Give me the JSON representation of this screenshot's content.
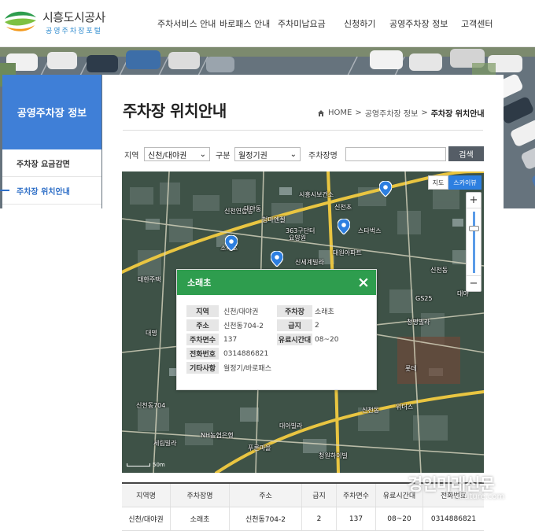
{
  "header": {
    "logo_name": "시흥도시공사",
    "logo_sub": "공영주차장포털",
    "nav": [
      "주차서비스 안내",
      "바로패스 안내",
      "주차미납요금",
      "신청하기",
      "공영주차장 정보",
      "고객센터"
    ]
  },
  "sidebar": {
    "title": "공영주차장 정보",
    "items": [
      {
        "label": "주차장 요금감면"
      },
      {
        "label": "주차장 위치안내"
      }
    ]
  },
  "page": {
    "title": "주차장 위치안내",
    "breadcrumb": {
      "home": "HOME",
      "sep": ">",
      "parent": "공영주차장 정보",
      "current": "주차장 위치안내"
    }
  },
  "filter": {
    "region_label": "지역",
    "region_value": "신천/대야권",
    "type_label": "구분",
    "type_value": "월정기권",
    "name_label": "주차장명",
    "name_value": "",
    "search_label": "검색"
  },
  "map": {
    "type_map": "지도",
    "type_sky": "스카이뷰",
    "zoom_in": "+",
    "zoom_out": "−",
    "labels": [
      "시흥시보건소",
      "신천연합동",
      "대야동",
      "363구단터",
      "요양원",
      "스타벅스",
      "청마엔젤",
      "신세계빌라",
      "대원아파트",
      "신천초",
      "GS25",
      "대야",
      "신천동",
      "대한주택",
      "소래초",
      "롯데",
      "청명빌라",
      "대명",
      "위더스",
      "NH농협은행",
      "신천동",
      "세림빌라",
      "청원하이빌",
      "푸른마을",
      "대아빌라",
      "신천동704"
    ],
    "scale": "50m",
    "popup": {
      "title": "소래초",
      "close": "×",
      "rows": [
        {
          "l1": "지역",
          "v1": "신천/대야권",
          "l2": "주차장",
          "v2": "소래초"
        },
        {
          "l1": "주소",
          "v1": "신천동704-2",
          "l2": "급지",
          "v2": "2"
        },
        {
          "l1": "주차면수",
          "v1": "137",
          "l2": "유료시간대",
          "v2": "08~20"
        },
        {
          "l1": "전화번호",
          "v1": "0314886821"
        },
        {
          "l1": "기타사항",
          "v1": "월정기/바로패스"
        }
      ]
    }
  },
  "table": {
    "headers": [
      "지역명",
      "주차장명",
      "주소",
      "급지",
      "주차면수",
      "유료시간대",
      "전화번호"
    ],
    "rows": [
      [
        "신천/대야권",
        "소래초",
        "신천동704-2",
        "2",
        "137",
        "08~20",
        "0314886821"
      ]
    ]
  },
  "watermark": {
    "brand": "경인미래신문",
    "url": "kifuture.com"
  },
  "colors": {
    "primary_blue": "#3f7fd7",
    "popup_green": "#2e9d4e",
    "search_button": "#555d66",
    "map_pin": "#2d7fe0"
  }
}
